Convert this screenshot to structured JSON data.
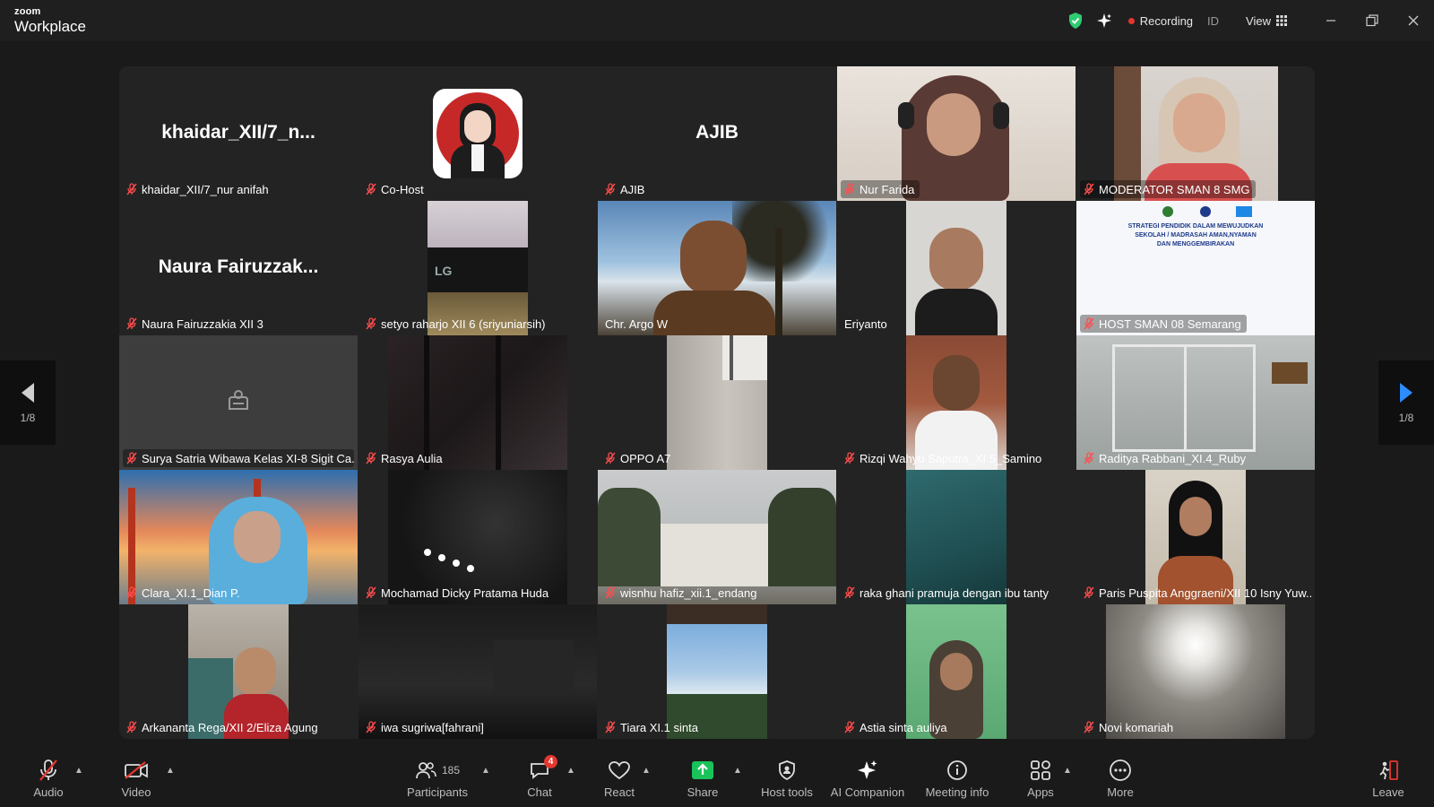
{
  "app": {
    "brand_top": "zoom",
    "brand_main": "Workplace"
  },
  "topbar": {
    "recording_label": "Recording",
    "id_label": "ID",
    "view_label": "View",
    "accent_green": "#2ecc71",
    "recording_color": "#e5362f"
  },
  "pager": {
    "left_page": "1/8",
    "right_page": "1/8"
  },
  "tiles": [
    {
      "name": "khaidar_XII/7_nur anifah",
      "big": "khaidar_XII/7_n..."
    },
    {
      "name": "Co-Host"
    },
    {
      "name": "AJIB",
      "big": "AJIB"
    },
    {
      "name": "Nur Farida"
    },
    {
      "name": "MODERATOR SMAN 8 SMG"
    },
    {
      "name": "Naura Fairuzzakia XII 3",
      "big": "Naura  Fairuzzak..."
    },
    {
      "name": "setyo raharjo XII 6 (sriyuniarsih)"
    },
    {
      "name": "Chr. Argo W"
    },
    {
      "name": "Eriyanto"
    },
    {
      "name": "HOST SMAN 08 Semarang"
    },
    {
      "name": "Surya Satria Wibawa Kelas XI-8 Sigit Ca..."
    },
    {
      "name": "Rasya Aulia"
    },
    {
      "name": "OPPO A7"
    },
    {
      "name": "Rizqi Wahyu Saputra_XI 5_Samino"
    },
    {
      "name": "Raditya Rabbani_XI.4_Ruby"
    },
    {
      "name": "Clara_XI.1_Dian P."
    },
    {
      "name": "Mochamad Dicky Pratama Huda"
    },
    {
      "name": "wisnhu hafiz_xii.1_endang"
    },
    {
      "name": "raka ghani pramuja dengan ibu tanty"
    },
    {
      "name": "Paris Puspita Anggraeni/XII 10 Isny Yuw..."
    },
    {
      "name": "Arkananta Rega/XII 2/Eliza Agung"
    },
    {
      "name": "iwa sugriwa[fahrani]"
    },
    {
      "name": "Tiara XI.1 sinta"
    },
    {
      "name": "Astia sinta auliya"
    },
    {
      "name": "Novi komariah"
    }
  ],
  "slide": {
    "line1": "STRATEGI PENDIDIK DALAM MEWUJUDKAN",
    "line2": "SEKOLAH / MADRASAH AMAN,NYAMAN",
    "line3": "DAN MENGGEMBIRAKAN"
  },
  "toolbar": {
    "audio": "Audio",
    "video": "Video",
    "participants": "Participants",
    "participants_count": "185",
    "chat": "Chat",
    "chat_badge": "4",
    "react": "React",
    "share": "Share",
    "host_tools": "Host tools",
    "ai_companion": "AI Companion",
    "meeting_info": "Meeting info",
    "apps": "Apps",
    "more": "More",
    "leave": "Leave",
    "share_color": "#19c35a"
  }
}
